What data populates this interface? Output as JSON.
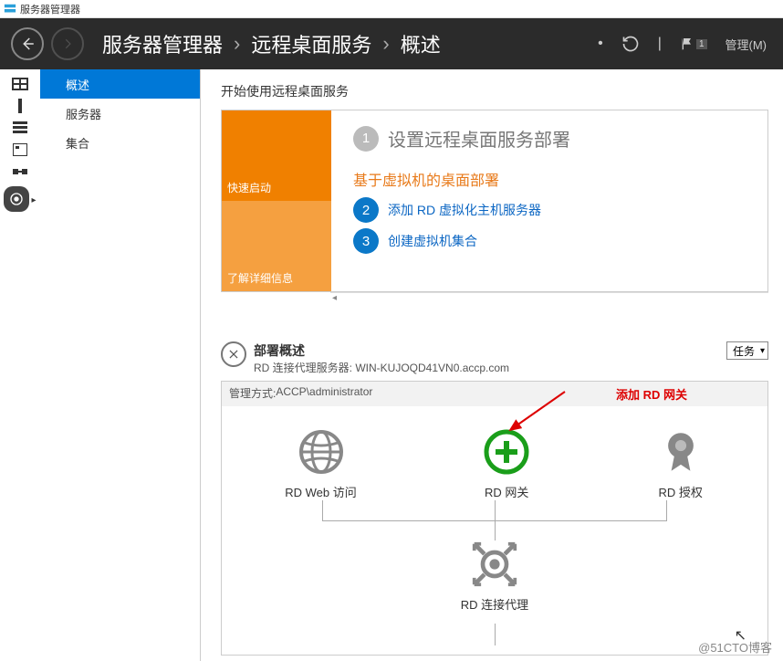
{
  "window_title": "服务器管理器",
  "header": {
    "breadcrumbs": [
      "服务器管理器",
      "远程桌面服务",
      "概述"
    ],
    "flag_badge": "1",
    "manage_label": "管理(M)"
  },
  "sidebar": {
    "items": [
      {
        "label": "概述",
        "selected": true
      },
      {
        "label": "服务器",
        "selected": false
      },
      {
        "label": "集合",
        "selected": false
      }
    ]
  },
  "getting_started": {
    "section_title": "开始使用远程桌面服务",
    "tile_quickstart": "快速启动",
    "tile_learnmore": "了解详细信息",
    "heading_num": "1",
    "heading_text": "设置远程桌面服务部署",
    "sub_heading": "基于虚拟机的桌面部署",
    "step2_num": "2",
    "step2_text": "添加 RD 虚拟化主机服务器",
    "step3_num": "3",
    "step3_text": "创建虚拟机集合"
  },
  "deployment": {
    "title": "部署概述",
    "subtitle_prefix": "RD 连接代理服务器: ",
    "broker_server": "WIN-KUJOQD41VN0.accp.com",
    "tasks_label": "任务",
    "mgmt_prefix": "管理方式: ",
    "mgmt_value": "ACCP\\administrator",
    "annotation": "添加 RD 网关",
    "nodes": {
      "web": "RD Web 访问",
      "gateway": "RD 网关",
      "license": "RD 授权",
      "broker": "RD 连接代理"
    }
  },
  "watermark": "@51CTO博客"
}
